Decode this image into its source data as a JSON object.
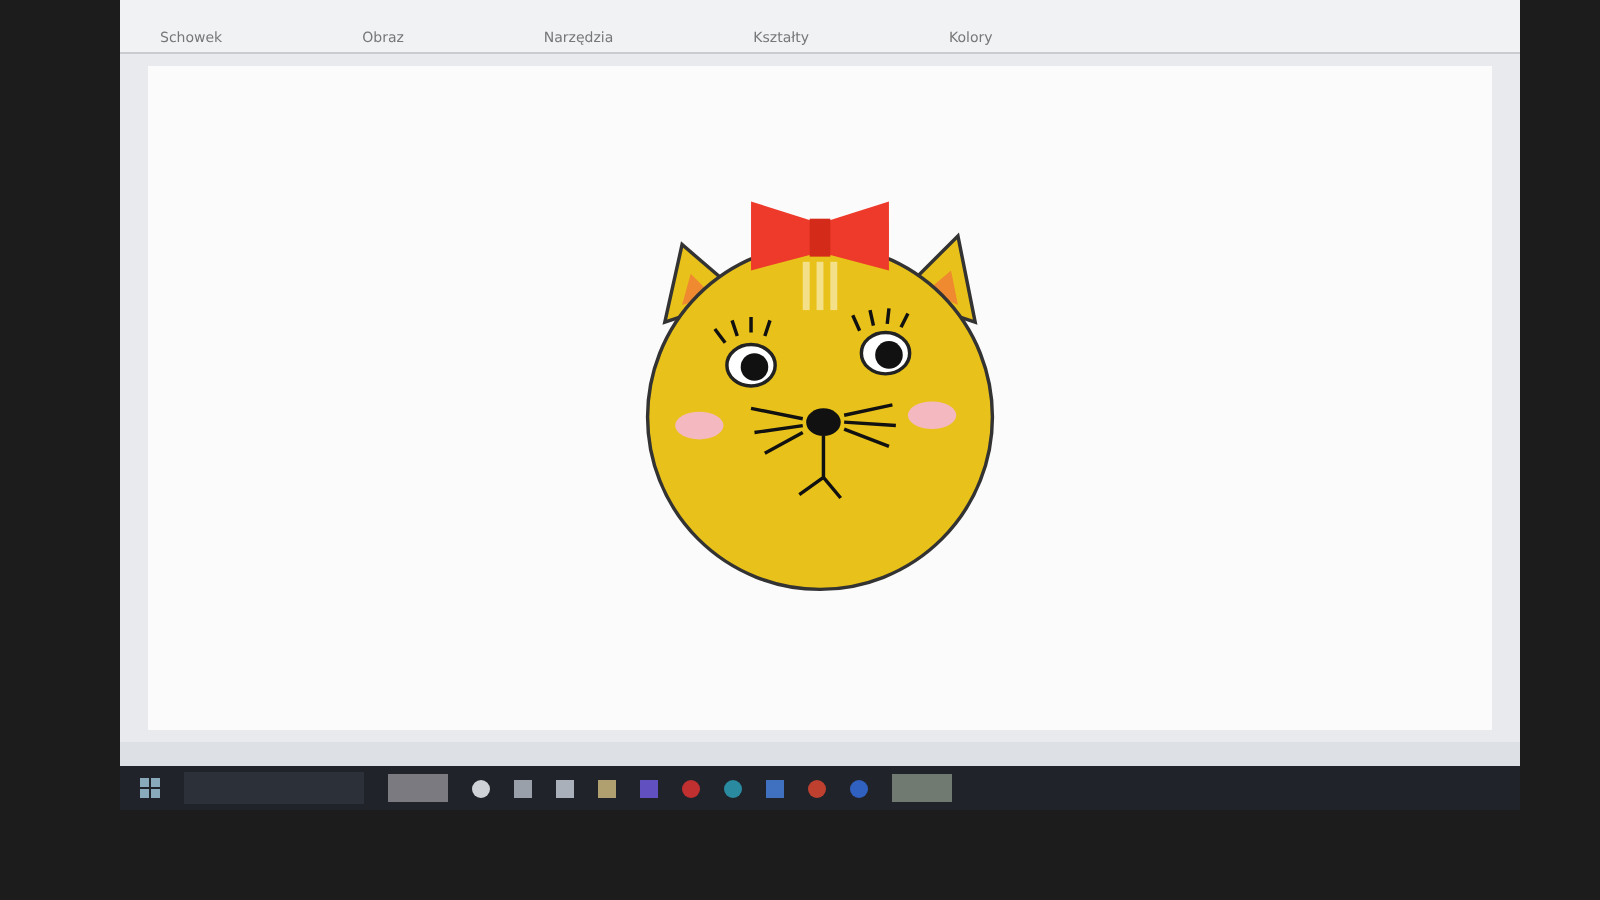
{
  "ribbon": {
    "groups": [
      {
        "label": "Schowek"
      },
      {
        "label": "Obraz"
      },
      {
        "label": "Narzędzia"
      },
      {
        "label": "Kształty"
      },
      {
        "label": "Kolory"
      }
    ]
  },
  "taskbar": {
    "apps": [
      {
        "kind": "thumb"
      },
      {
        "kind": "circle"
      },
      {
        "kind": "square"
      },
      {
        "kind": "square"
      },
      {
        "kind": "square"
      },
      {
        "kind": "square"
      },
      {
        "kind": "circle"
      },
      {
        "kind": "circle"
      },
      {
        "kind": "square"
      },
      {
        "kind": "circle"
      },
      {
        "kind": "circle"
      },
      {
        "kind": "thumb"
      }
    ]
  }
}
